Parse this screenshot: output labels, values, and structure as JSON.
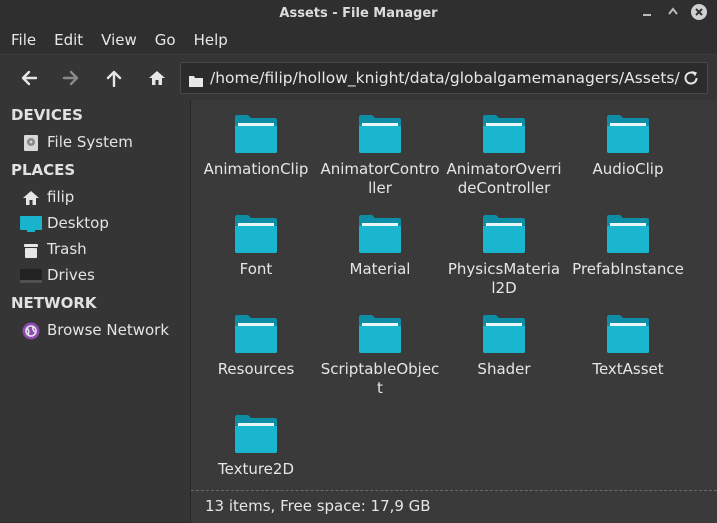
{
  "window": {
    "title": "Assets - File Manager",
    "minimize_icon": "minimize-icon",
    "maximize_icon": "maximize-icon",
    "close_icon": "close-icon"
  },
  "menu": [
    "File",
    "Edit",
    "View",
    "Go",
    "Help"
  ],
  "toolbar": {
    "back_icon": "back-arrow-icon",
    "forward_icon": "forward-arrow-icon",
    "up_icon": "up-arrow-icon",
    "home_icon": "home-icon",
    "path": "/home/filip/hollow_knight/data/globalgamemanagers/Assets/",
    "reload_icon": "reload-icon"
  },
  "sidebar": {
    "devices_heading": "DEVICES",
    "devices": [
      {
        "label": "File System",
        "icon": "hard-disk-icon"
      }
    ],
    "places_heading": "PLACES",
    "places": [
      {
        "label": "filip",
        "icon": "home-icon"
      },
      {
        "label": "Desktop",
        "icon": "desktop-icon"
      },
      {
        "label": "Trash",
        "icon": "trash-icon"
      },
      {
        "label": "Drives",
        "icon": "drive-icon"
      }
    ],
    "network_heading": "NETWORK",
    "network": [
      {
        "label": "Browse Network",
        "icon": "network-globe-icon"
      }
    ]
  },
  "files": [
    {
      "name": "AnimationClip",
      "lines": [
        "AnimationClip"
      ]
    },
    {
      "name": "AnimatorController",
      "lines": [
        "AnimatorContro",
        "ller"
      ]
    },
    {
      "name": "AnimatorOverrideController",
      "lines": [
        "AnimatorOverri",
        "deController"
      ]
    },
    {
      "name": "AudioClip",
      "lines": [
        "AudioClip"
      ]
    },
    {
      "name": "Font",
      "lines": [
        "Font"
      ]
    },
    {
      "name": "Material",
      "lines": [
        "Material"
      ]
    },
    {
      "name": "PhysicsMaterial2D",
      "lines": [
        "PhysicsMateria",
        "l2D"
      ]
    },
    {
      "name": "PrefabInstance",
      "lines": [
        "PrefabInstance"
      ]
    },
    {
      "name": "Resources",
      "lines": [
        "Resources"
      ]
    },
    {
      "name": "ScriptableObject",
      "lines": [
        "ScriptableObjec",
        "t"
      ]
    },
    {
      "name": "Shader",
      "lines": [
        "Shader"
      ]
    },
    {
      "name": "TextAsset",
      "lines": [
        "TextAsset"
      ]
    },
    {
      "name": "Texture2D",
      "lines": [
        "Texture2D"
      ]
    }
  ],
  "status": "13 items, Free space: 17,9 GB",
  "colors": {
    "folder": "#1ab5cf",
    "folder_dark": "#0e8ea6",
    "accent_globe": "#8a4bb3"
  }
}
